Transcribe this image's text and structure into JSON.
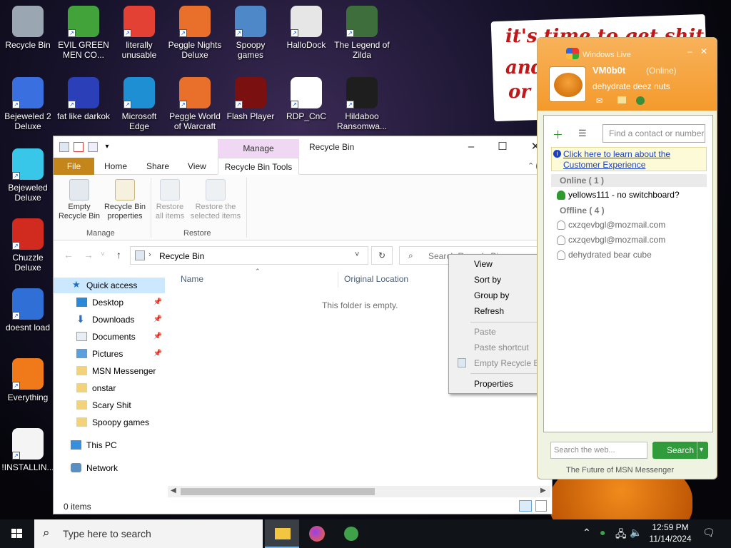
{
  "desktop": {
    "icons": [
      {
        "label": "Recycle Bin",
        "color": "#9aa7b3"
      },
      {
        "label": "EVIL GREEN MEN CO...",
        "color": "#43a33b"
      },
      {
        "label": "literally unusable",
        "color": "#e34133"
      },
      {
        "label": "Peggle Nights Deluxe",
        "color": "#e8702a"
      },
      {
        "label": "Spoopy games",
        "color": "#4f88c8"
      },
      {
        "label": "HalloDock",
        "color": "#e6e6e6"
      },
      {
        "label": "The Legend of Zilda",
        "color": "#3e6e3c"
      },
      {
        "label": "Bejeweled 2 Deluxe",
        "color": "#3a6fe0"
      },
      {
        "label": "fat like darkok",
        "color": "#2a3fb8"
      },
      {
        "label": "Microsoft Edge",
        "color": "#1f8fd3"
      },
      {
        "label": "Peggle World of Warcraft",
        "color": "#e8702a"
      },
      {
        "label": "Flash Player",
        "color": "#7a1010"
      },
      {
        "label": "RDP_CnC",
        "color": "#ffffff"
      },
      {
        "label": "Hildaboo Ransomwa...",
        "color": "#1e1e1e"
      },
      {
        "label": "Bejeweled Deluxe",
        "color": "#38c7e8"
      },
      {
        "label": "Chuzzle Deluxe",
        "color": "#d12a1f"
      },
      {
        "label": "doesnt load",
        "color": "#2f6fd6"
      },
      {
        "label": "Everything",
        "color": "#f07a1a"
      },
      {
        "label": "!INSTALLIN...",
        "color": "#f4f4f4"
      }
    ],
    "wallpaper_text": [
      "it's time to get shit",
      "and",
      "or t"
    ]
  },
  "explorer": {
    "window_title": "Recycle Bin",
    "contextual_tab": "Manage",
    "tabs": {
      "file": "File",
      "home": "Home",
      "share": "Share",
      "view": "View",
      "tools": "Recycle Bin Tools"
    },
    "ribbon": {
      "empty": "Empty Recycle Bin",
      "properties": "Recycle Bin properties",
      "restore_all": "Restore all items",
      "restore_selected": "Restore the selected items",
      "group_manage": "Manage",
      "group_restore": "Restore"
    },
    "address": "Recycle Bin",
    "search_placeholder": "Search Recycle Bin",
    "nav": {
      "quick_access": "Quick access",
      "desktop": "Desktop",
      "downloads": "Downloads",
      "documents": "Documents",
      "pictures": "Pictures",
      "msn": "MSN Messenger",
      "onstar": "onstar",
      "scary": "Scary Shit",
      "spoopy": "Spoopy games",
      "thispc": "This PC",
      "network": "Network"
    },
    "columns": {
      "name": "Name",
      "original_location": "Original Location"
    },
    "empty_message": "This folder is empty.",
    "status": "0 items"
  },
  "context_menu": {
    "view": "View",
    "sort_by": "Sort by",
    "group_by": "Group by",
    "refresh": "Refresh",
    "paste": "Paste",
    "paste_shortcut": "Paste shortcut",
    "empty_recycle_bin": "Empty Recycle Bin",
    "properties": "Properties"
  },
  "messenger": {
    "title": "Windows Live",
    "username": "VM0b0t",
    "status": "(Online)",
    "personal_message": "dehydrate deez nuts",
    "find_placeholder": "Find a contact or number",
    "notice": "Click here to learn about the Customer Experience",
    "online_group": "Online ( 1 )",
    "offline_group": "Offline ( 4 )",
    "online_contacts": [
      "yellows111 - no switchboard?"
    ],
    "offline_contacts": [
      "cxzqevbgl@mozmail.com",
      "cxzqevbgl@mozmail.com",
      "dehydrated bear cube"
    ],
    "web_search_placeholder": "Search the web...",
    "search_button": "Search",
    "footer": "The Future of MSN Messenger",
    "online_color": "#2e9a2e"
  },
  "taskbar": {
    "search_placeholder": "Type here to search",
    "time": "12:59 PM",
    "date": "11/14/2024"
  }
}
